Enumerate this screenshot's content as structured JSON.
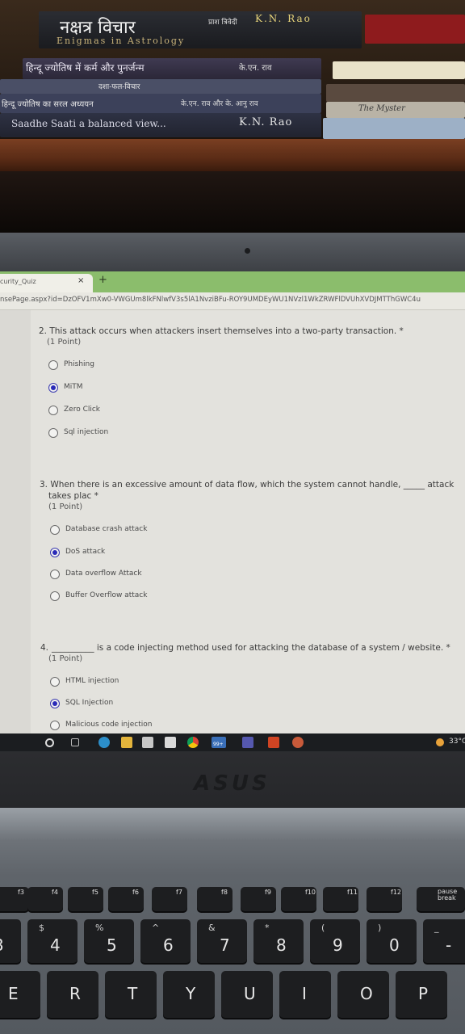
{
  "books": {
    "top_hindi": "नक्षत्र विचार",
    "top_enigmas": "Enigmas in Astrology",
    "top_right_hindi": "प्राश त्रिवेदी",
    "top_author": "K.N. Rao",
    "second_hindi": "हिन्दू ज्योतिष में कर्म और पुनर्जन्म",
    "second_author_hindi": "के.एन. राव",
    "third_hindi": "दशा-फल-विचार",
    "fourth_hindi": "हिन्दू ज्योतिष का सरल अध्ययन",
    "fourth_author_hindi": "के.एन. राव और के. आनु राव",
    "bottom_title": "Saadhe Saati a balanced view...",
    "bottom_author": "K.N. Rao",
    "right_lower": "The Myster"
  },
  "browser": {
    "tab_title": "curity_Quiz",
    "tab_close": "×",
    "tab_new": "+",
    "url": "nsePage.aspx?id=DzOFV1mXw0-VWGUm8lkFNlwfV3s5lA1NvziBFu-ROY9UMDEyWU1NVzl1WkZRWFlDVUhXVDJMTThGWC4u"
  },
  "questions": [
    {
      "text": "2. This attack occurs when attackers insert themselves into a two-party transaction. *",
      "points": "(1 Point)",
      "options": [
        {
          "label": "Phishing",
          "selected": false
        },
        {
          "label": "MiTM",
          "selected": true
        },
        {
          "label": "Zero Click",
          "selected": false
        },
        {
          "label": "Sql injection",
          "selected": false
        }
      ]
    },
    {
      "text_line1": "3. When there is an excessive amount of data flow, which the system cannot handle, _____ attack",
      "text_line2": "takes plac *",
      "points": "(1 Point)",
      "options": [
        {
          "label": "Database crash attack",
          "selected": false
        },
        {
          "label": "DoS attack",
          "selected": true
        },
        {
          "label": "Data overflow Attack",
          "selected": false
        },
        {
          "label": "Buffer Overflow attack",
          "selected": false
        }
      ]
    },
    {
      "number": "4.",
      "text": "__________ is a code injecting method used for attacking the database of a system / website. *",
      "points": "(1 Point)",
      "options": [
        {
          "label": "HTML injection",
          "selected": false
        },
        {
          "label": "SQL Injection",
          "selected": true
        },
        {
          "label": "Malicious code injection",
          "selected": false
        }
      ]
    }
  ],
  "taskbar": {
    "temperature": "33°C",
    "badge": "99+"
  },
  "laptop": {
    "brand": "ASUS",
    "fkeys": [
      "f3",
      "f4",
      "f5",
      "f6",
      "f7",
      "f8",
      "f9",
      "f10",
      "f11",
      "f12",
      "pause break"
    ],
    "number_row": [
      {
        "main": "3",
        "sub": ""
      },
      {
        "main": "4",
        "sub": "$"
      },
      {
        "main": "5",
        "sub": "%"
      },
      {
        "main": "6",
        "sub": "^"
      },
      {
        "main": "7",
        "sub": "&"
      },
      {
        "main": "8",
        "sub": "*"
      },
      {
        "main": "9",
        "sub": "("
      },
      {
        "main": "0",
        "sub": ")"
      },
      {
        "main": "-",
        "sub": "_"
      }
    ],
    "letter_row": [
      "E",
      "R",
      "T",
      "Y",
      "U",
      "I",
      "O",
      "P"
    ]
  },
  "colors": {
    "tab_bar": "#8bbd6c",
    "selected_radio": "#2a2ab8",
    "page_background": "#e3e2dd"
  }
}
